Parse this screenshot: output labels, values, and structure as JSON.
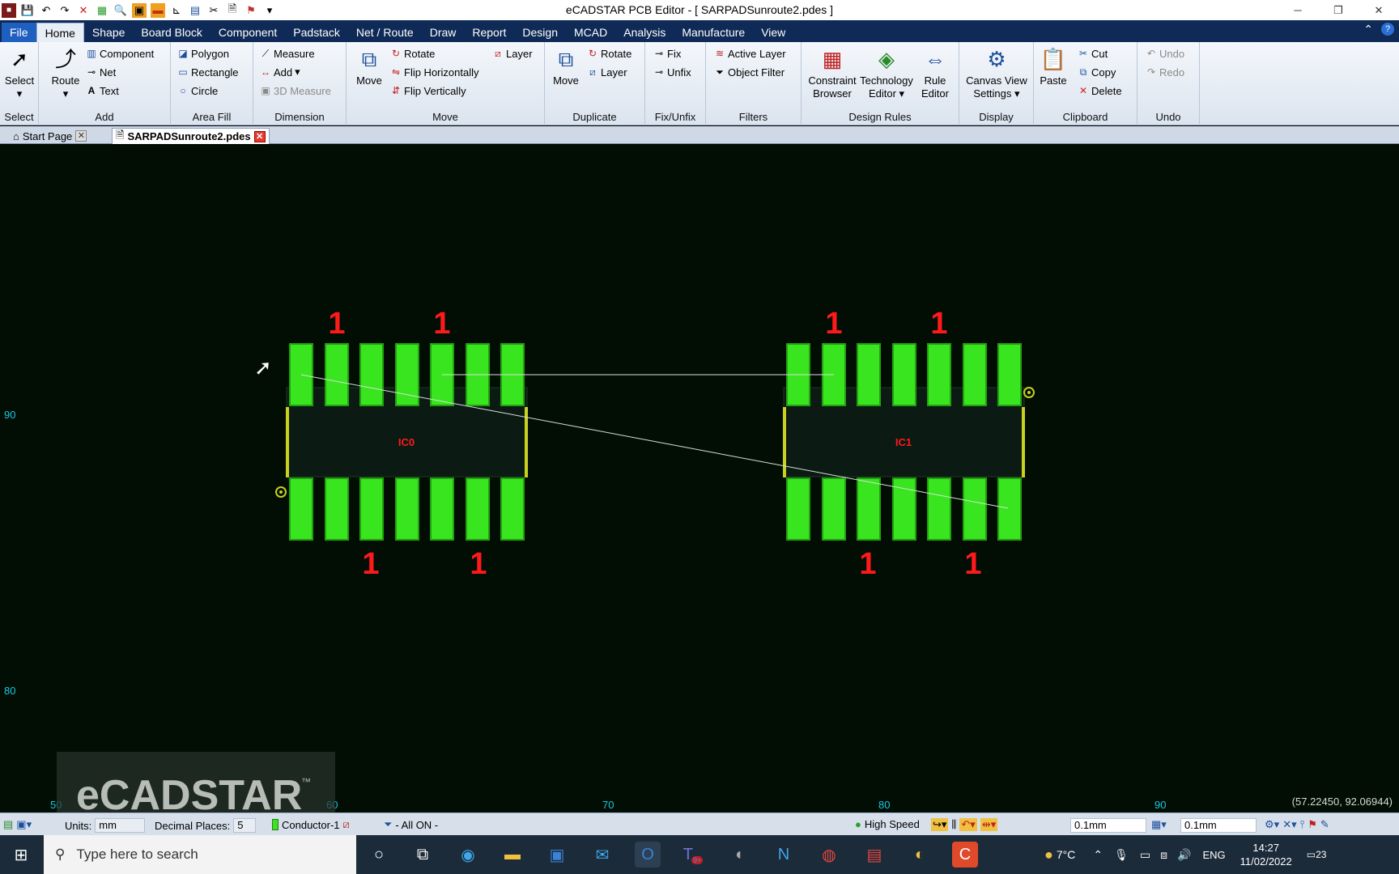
{
  "window": {
    "title": "eCADSTAR PCB Editor - [ SARPADSunroute2.pdes ]"
  },
  "menu": {
    "file": "File",
    "tabs": [
      "Home",
      "Shape",
      "Board Block",
      "Component",
      "Padstack",
      "Net / Route",
      "Draw",
      "Report",
      "Design",
      "MCAD",
      "Analysis",
      "Manufacture",
      "View"
    ]
  },
  "ribbon": {
    "select": {
      "label": "Select",
      "group": "Select"
    },
    "add": {
      "route": "Route",
      "component": "Component",
      "net": "Net",
      "text": "Text",
      "group": "Add"
    },
    "area_fill": {
      "polygon": "Polygon",
      "rectangle": "Rectangle",
      "circle": "Circle",
      "group": "Area Fill"
    },
    "dimension": {
      "measure": "Measure",
      "add": "Add",
      "measure3d": "3D Measure",
      "group": "Dimension"
    },
    "move": {
      "move": "Move",
      "rotate": "Rotate",
      "layer": "Layer",
      "flip_h": "Flip Horizontally",
      "flip_v": "Flip Vertically",
      "group": "Move"
    },
    "duplicate": {
      "move": "Move",
      "rotate": "Rotate",
      "layer": "Layer",
      "group": "Duplicate"
    },
    "fix": {
      "fix": "Fix",
      "unfix": "Unfix",
      "group": "Fix/Unfix"
    },
    "filters": {
      "active_layer": "Active Layer",
      "object_filter": "Object Filter",
      "group": "Filters"
    },
    "design_rules": {
      "constraint_1": "Constraint",
      "constraint_2": "Browser",
      "technology_1": "Technology",
      "technology_2": "Editor",
      "rule_1": "Rule",
      "rule_2": "Editor",
      "group": "Design Rules"
    },
    "display": {
      "canvas_1": "Canvas View",
      "canvas_2": "Settings",
      "group": "Display"
    },
    "clipboard": {
      "paste": "Paste",
      "cut": "Cut",
      "copy": "Copy",
      "delete": "Delete",
      "group": "Clipboard"
    },
    "undo": {
      "undo": "Undo",
      "redo": "Redo",
      "group": "Undo"
    }
  },
  "doc_tabs": {
    "start": "Start Page",
    "file": "SARPADSunroute2.pdes"
  },
  "canvas": {
    "components": [
      {
        "ref": "IC0",
        "pin1_labels": [
          "1",
          "1",
          "1",
          "1"
        ]
      },
      {
        "ref": "IC1",
        "pin1_labels": [
          "1",
          "1",
          "1",
          "1"
        ]
      }
    ],
    "pin1_label": "1",
    "y_axis": [
      "90",
      "80"
    ],
    "x_axis": [
      "50",
      "60",
      "70",
      "80",
      "90"
    ],
    "watermark": "eCADSTAR",
    "watermark_tm": "™",
    "coords": "(57.22450, 92.06944)"
  },
  "colors": {
    "pad": "#39e51f",
    "outline": "#c8d020",
    "label": "#ff1a1a",
    "axis": "#18c8e8",
    "canvas": "#020e03"
  },
  "status": {
    "units_label": "Units:",
    "units_value": "mm",
    "decimal_label": "Decimal Places:",
    "decimal_value": "5",
    "layer": "Conductor-1",
    "filter": "- All ON -",
    "high_speed": "High Speed",
    "grid1": "0.1mm",
    "grid2": "0.1mm"
  },
  "taskbar": {
    "search_placeholder": "Type here to search",
    "teams_badge": "9+",
    "temperature": "7°C",
    "language": "ENG",
    "time": "14:27",
    "date": "11/02/2022",
    "notifications": "23"
  }
}
